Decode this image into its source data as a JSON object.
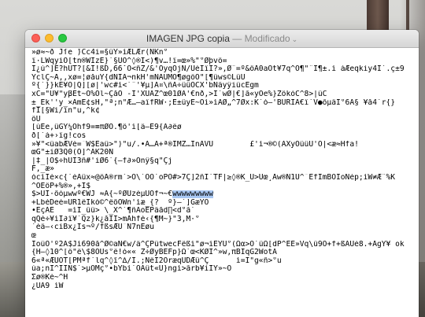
{
  "window": {
    "title": "IMAGEN JPG copia",
    "separator": " — ",
    "status": "Modificado",
    "chevron": "⌄"
  },
  "content": {
    "lines": [
      "»ø≈~ð Jſe ̈)Cc4i=§üY»ìÆLÆr(ÑKn°",
      "ï·LWqyiÓ[tn®WÎzÊ}`§ÚO^◊®Ï<)¶v…!ï=œ»%\"°Øþvô=",
      "Ï¿ú^]É?hÚT?[&Ï!ßD,66ˇO<ñZ/&'ÖyqÓjÑ/ÙéÏïÏ?»,Ø¨=º&ôÅ0aÕt¥7q^Õ¶\"¨Ï¶±.ì àÆeqkiy4Ï`.ç±9",
      "ŸclÇ~Å,,xø=¦øåuY{dÑÏÀ¬nkH'mÑÅÜMÕ¶øgöÔ\"[¶ûws©LûÛ",
      "º{`}}kÉ¥Ö|Q][ø|'wc#ì<`¨'¥µ]À¤\\ñÄ÷ûûOCX'bÑâyÿiücÈgm",
      "xC=\"U¥\"yβEt~Ò%Õl~ÇåÕ -Ï'XUÂZ^œ01ØÄ'€nð,>Ì`wØ|€]ã«yÕe%}ZökóC^8>|üC",
      "±_Ek''y_×ÃmÈ¢sH,\"ª;n\"Æ…–aïfRW·;É±ûyÉ~Ôì»ìÁØ„^7Øx:K`ò–'BÜRIÁ€ï`V●õµâÏ°6A§ ¥å4`r{}",
      "fÎ[§Wi/ïn\"u,^k¢",
      "ôÜ",
      "[úÉe,ûGY¼Ôhf9=≡πØÒ.¶ô'ì[ä—É9{Á∂ëø",
      "ð[`à+›ïg!cos",
      "»¥\"<üabÆVé=¯W$Ëaü>\")\"u/.•Â…Ä+ª®IMZ…ÏnÅVÜ        £'ì¬®©(ÀXyÔûüÜ'Ô|<æ≈Hfa!",
      "œG\"±iØ3Q0(Ö]^ÁK20Ñ",
      "|‡_|Ó$÷hÛI3ñ#'iØ6`{–f∂»Ônÿ§q\"Çj",
      "F,_æ»",
      "ócìÌè×c{`éÁûx≈@öÅ®rm`>Ö\\`ÓÒ`oPÓ#>7Ç]2ñÏ`TF|≥◊®K_Ù>Üœ¸Åw®Ñ1U^¯ÉfÎmBÖIoÑép;ìW≠Æ¨%K",
      "^ÖÉöP+%®»‚+Í$",
      "$>ÜI·õòµwwº€WJ ≈A{~ºØÜzéµÜÔf¬~€wwwwwwwww",
      "+LbéDeé=UR1ëÌkó©^êõÒWn'ìæ_{?  º}–`]GæYÖ",
      "•ÉçÃÉ   =ìÏ_ûü> \\_X^`¶ñAoÉPâåd∏<d°ã`",
      "qQè÷¥ìÏ∂ï¥`Qz}k¿åÏÌ>mÅhfé‹{¶M~}\"3,M·°",
      "`èâ—‹ciBx¿Ìs¬º/fßsÆÙ¯N7nÉøu",
      "œ",
      "ÎoüÖ'º2Ä$Jì690å^Ø©aÑ€w/ä^ÇPütwecFêßì\"ø¬ìÈYU°(Ωα>Ó`ûΩ[dP^ÈÊ»Vq\\û9Ó+f+ßÀÜé8.+ÅgY¥ ok",
      "{H–◊10^[ö\"ë\\$8ÖUs°ê!ò«« Z÷ØyBEFp}Ω`œ<KØÍ^»w,πBÌqG2WotÀ",
      "6«ª«ÆÜÖT[PMªf´lq^◊î^∆/Í.;ÑëÌ2ÕræqÜDÆû^Ç      ì=Ï\"g«ñ>°u",
      "ùa;nÎ^ÍIÑ$`>µÖMç°•bYbí`ÖÀût«Ü}ngì>ãrb¥iÏŸ»~Õ",
      "Σø®Ké~^H",
      "¿ÜA9 ìW"
    ],
    "selected_run": "wwwwwwwww"
  }
}
